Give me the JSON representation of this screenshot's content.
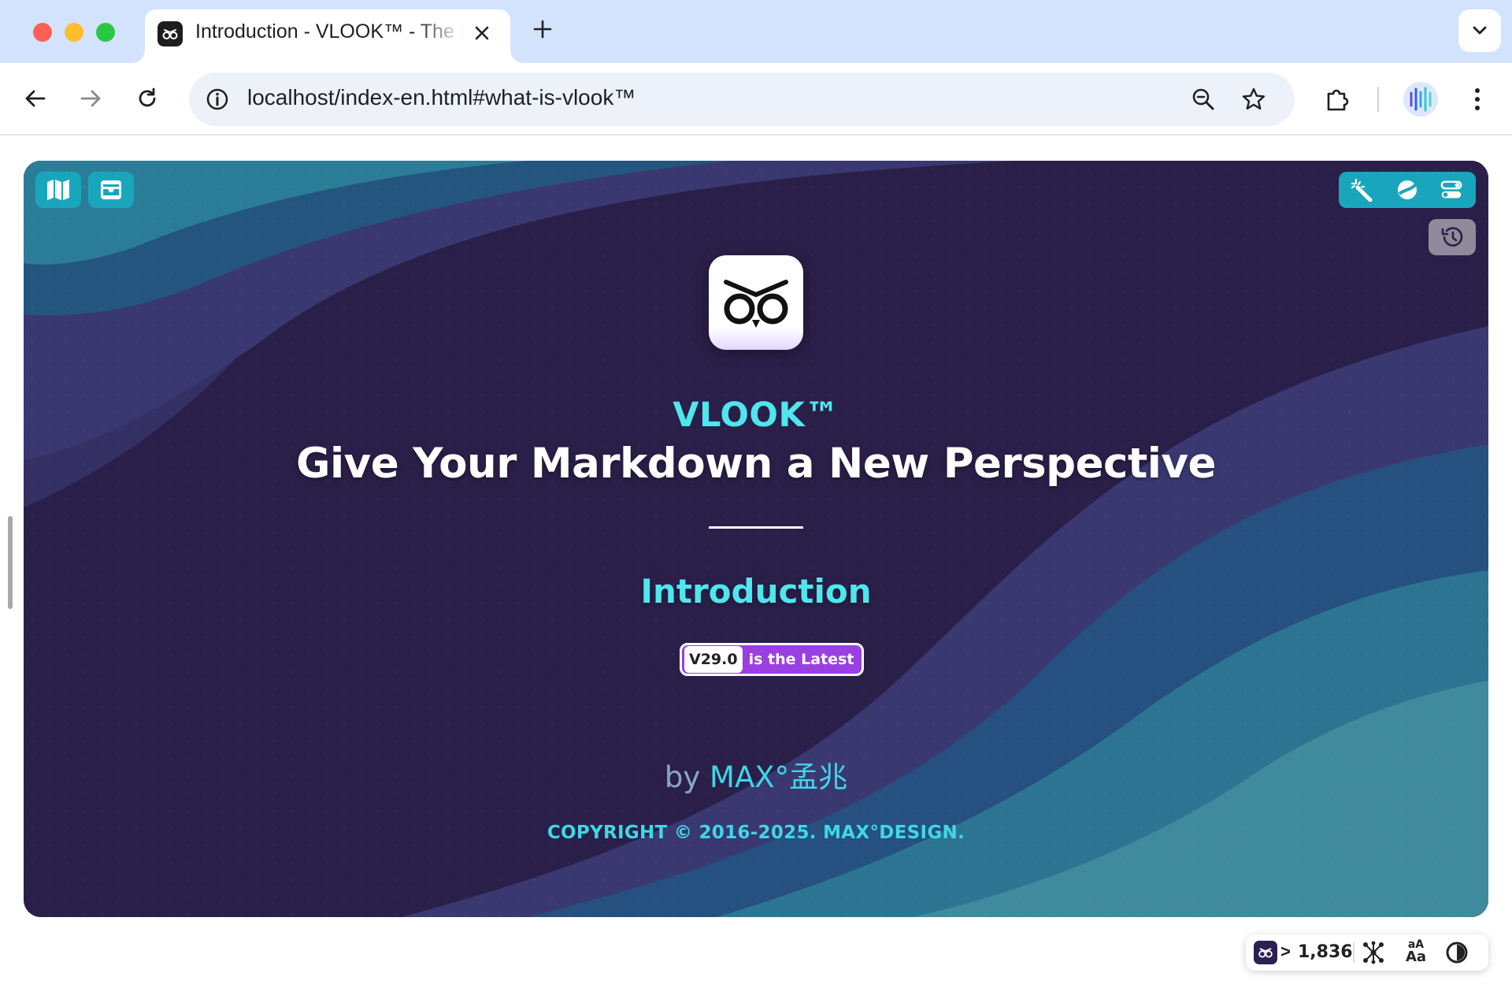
{
  "browser": {
    "tab": {
      "title": "Introduction - VLOOK™ - The Elegant & Practical Typora Theme"
    },
    "omnibox": {
      "url": "localhost/index-en.html#what-is-vlook™"
    },
    "icons": {
      "close": "close-icon",
      "new_tab": "plus-icon",
      "tab_menu": "chevron-down-icon",
      "back": "arrow-left-icon",
      "forward": "arrow-right-icon",
      "reload": "reload-icon",
      "info": "info-icon",
      "zoom": "zoom-icon",
      "bookmark": "star-icon",
      "extensions": "puzzle-icon",
      "menu": "kebab-icon"
    }
  },
  "cover": {
    "brand": "VLOOK™",
    "headline": "Give Your Markdown a New Perspective",
    "section_title": "Introduction",
    "version_number": "V29.0",
    "version_label": "is the Latest",
    "author_prefix": "by",
    "author_name": "MAX°孟兆",
    "copyright": "COPYRIGHT © 2016-2025. MAX°DESIGN.",
    "colors": {
      "accent": "#4fe6ee",
      "background": "#2a1f48",
      "button": "#19a6bd",
      "badge": "#9a3fe2"
    },
    "left_buttons": [
      "map-icon",
      "inbox-icon"
    ],
    "right_buttons": [
      "magic-wand-icon",
      "theme-icon",
      "settings-icon"
    ],
    "history_button": "history-icon"
  },
  "status_bar": {
    "chevron": ">",
    "count": "1,836",
    "font_small": "aA",
    "font_big": "Aa",
    "icons": [
      "vlook-logo-icon",
      "network-icon",
      "font-size-icon",
      "contrast-icon"
    ]
  }
}
